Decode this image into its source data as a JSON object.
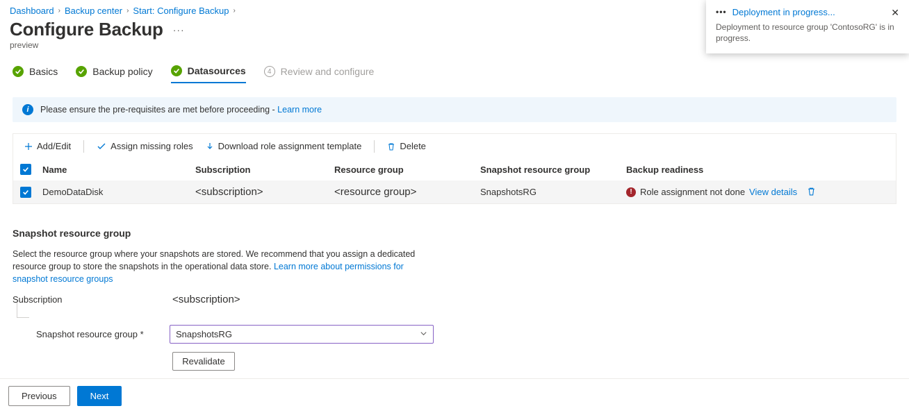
{
  "breadcrumb": {
    "items": [
      "Dashboard",
      "Backup center",
      "Start: Configure Backup"
    ]
  },
  "header": {
    "title": "Configure Backup",
    "subtitle": "preview"
  },
  "stepper": {
    "steps": [
      {
        "label": "Basics",
        "state": "done"
      },
      {
        "label": "Backup policy",
        "state": "done"
      },
      {
        "label": "Datasources",
        "state": "active"
      },
      {
        "label": "Review and configure",
        "state": "disabled",
        "num": "4"
      }
    ]
  },
  "banner": {
    "text": "Please ensure the pre-requisites are met before proceeding - ",
    "link": "Learn more"
  },
  "toolbar": {
    "add": "Add/Edit",
    "assign": "Assign missing roles",
    "download": "Download role assignment template",
    "delete": "Delete"
  },
  "table": {
    "headers": {
      "name": "Name",
      "subscription": "Subscription",
      "rg": "Resource group",
      "srg": "Snapshot resource group",
      "readiness": "Backup readiness"
    },
    "rows": [
      {
        "name": "DemoDataDisk",
        "subscription": "<subscription>",
        "rg": "<resource group>",
        "srg": "SnapshotsRG",
        "readiness": "Role assignment not done",
        "details": "View details"
      }
    ]
  },
  "srg": {
    "heading": "Snapshot resource group",
    "desc1": "Select the resource group where your snapshots are stored. We recommend that you assign a dedicated resource group to store the snapshots in the operational data store. ",
    "desc_link": "Learn more about permissions for snapshot resource groups",
    "subLabel": "Subscription",
    "subValue": "<subscription>",
    "srgLabel": "Snapshot resource group *",
    "srgValue": "SnapshotsRG",
    "revalidate": "Revalidate"
  },
  "footer": {
    "prev": "Previous",
    "next": "Next"
  },
  "toast": {
    "title": "Deployment in progress...",
    "body": "Deployment to resource group 'ContosoRG' is in progress."
  }
}
